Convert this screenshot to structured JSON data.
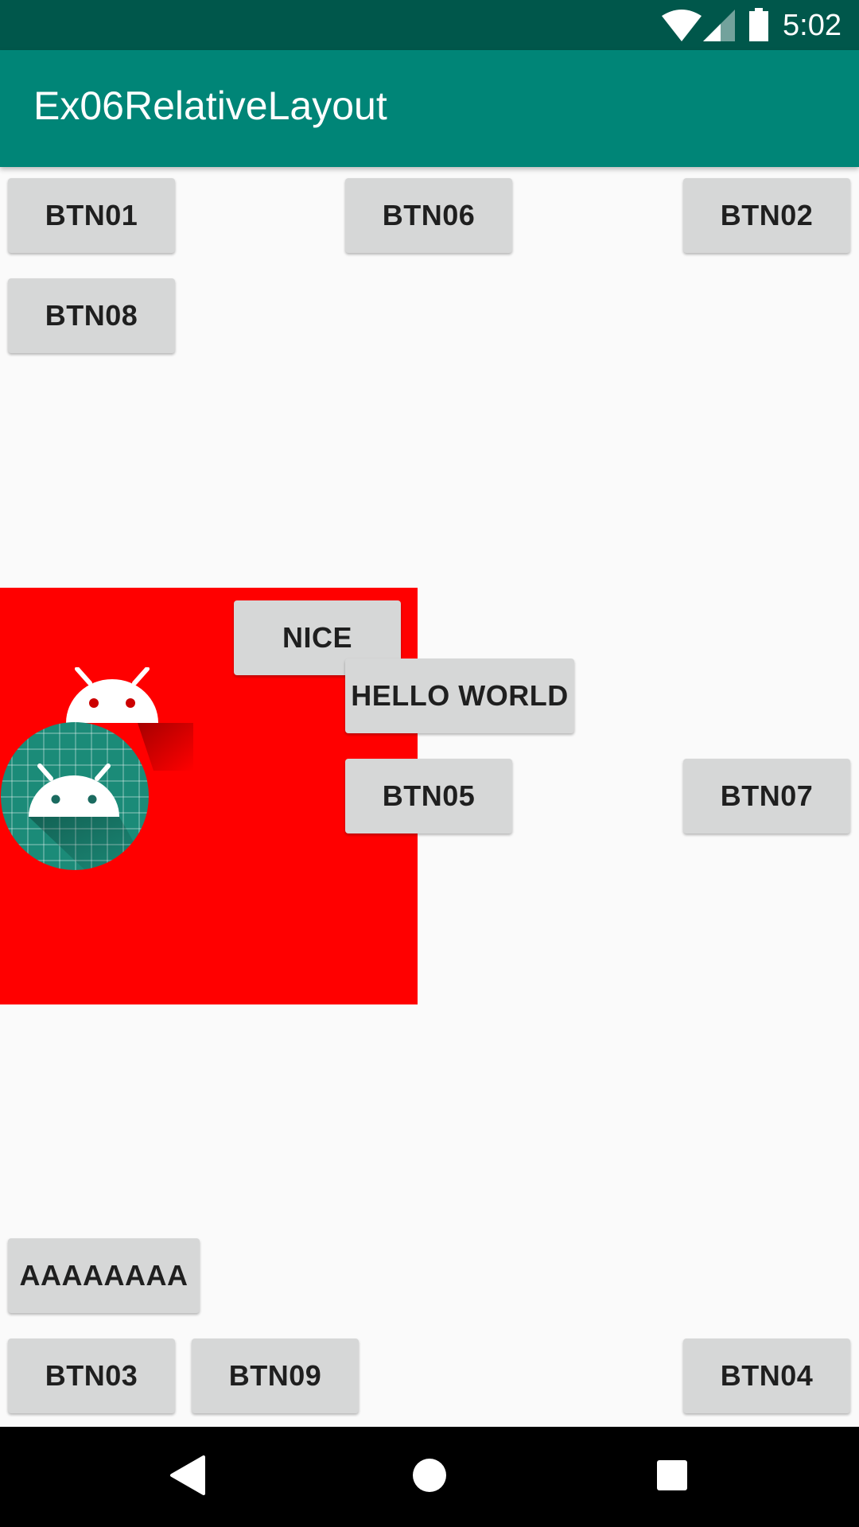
{
  "status_bar": {
    "time": "5:02",
    "icons": [
      "wifi-icon",
      "cell-signal-icon",
      "battery-icon"
    ]
  },
  "app_bar": {
    "title": "Ex06RelativeLayout",
    "color": "#008577"
  },
  "buttons": {
    "btn01": "BTN01",
    "btn06": "BTN06",
    "btn02": "BTN02",
    "btn08": "BTN08",
    "nice": "NICE",
    "hello_world": "HELLO WORLD",
    "btn05": "BTN05",
    "btn07": "BTN07",
    "aaaaaaaa": "AAAAAAAA",
    "btn03": "BTN03",
    "btn09": "BTN09",
    "btn04": "BTN04"
  },
  "red_panel": {
    "color": "#ff0000",
    "icons": [
      "android-head-icon",
      "android-launcher-icon"
    ]
  },
  "nav_bar": {
    "icons": [
      "back-icon",
      "home-icon",
      "recents-icon"
    ]
  }
}
